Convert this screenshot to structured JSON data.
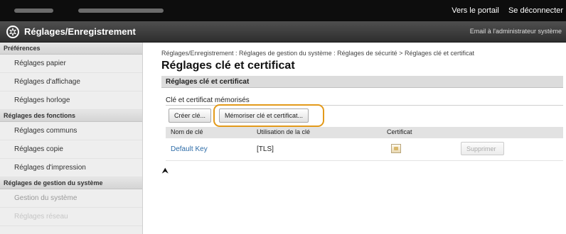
{
  "topbar": {
    "portal_link": "Vers le portail",
    "logout_link": "Se déconnecter"
  },
  "titlebar": {
    "app_title": "Réglages/Enregistrement",
    "admin_email": "Email à l'administrateur système"
  },
  "sidebar": {
    "sections": [
      {
        "title": "Préférences",
        "items": [
          "Réglages papier",
          "Réglages d'affichage",
          "Réglages horloge"
        ]
      },
      {
        "title": "Réglages des fonctions",
        "items": [
          "Réglages communs",
          "Réglages copie",
          "Réglages d'impression"
        ]
      },
      {
        "title": "Réglages de gestion du système",
        "items": [
          "Gestion du système",
          "Réglages réseau"
        ]
      }
    ]
  },
  "main": {
    "breadcrumb": "Réglages/Enregistrement : Réglages de gestion du système : Réglages de sécurité > Réglages clé et certificat",
    "page_title": "Réglages clé et certificat",
    "section_title": "Réglages clé et certificat",
    "subsection_title": "Clé et certificat mémorisés",
    "buttons": {
      "create_key": "Créer clé...",
      "register_key": "Mémoriser clé et certificat..."
    },
    "table": {
      "headers": [
        "Nom de clé",
        "Utilisation de la clé",
        "Certificat"
      ],
      "rows": [
        {
          "key_name": "Default Key",
          "usage": "[TLS]",
          "delete_label": "Supprimer"
        }
      ]
    },
    "top_arrow": "⮝"
  },
  "colors": {
    "highlight": "#e39a1a",
    "link": "#2d6ca8",
    "topbar": "#0d0d0d"
  }
}
